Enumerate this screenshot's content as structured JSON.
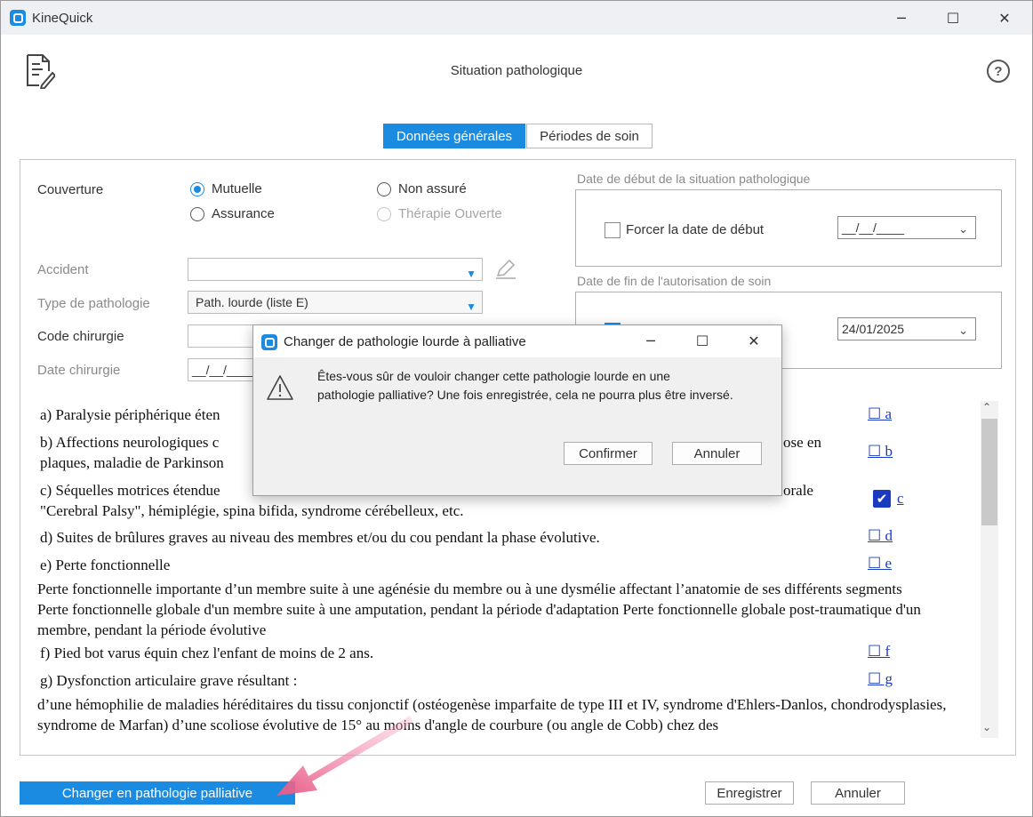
{
  "window": {
    "title": "KineQuick",
    "minimize_glyph": "─",
    "maximize_glyph": "☐",
    "close_glyph": "✕"
  },
  "header": {
    "title": "Situation pathologique",
    "help_glyph": "?"
  },
  "tabs": [
    {
      "label": "Données générales",
      "active": true
    },
    {
      "label": "Périodes de soin",
      "active": false
    }
  ],
  "form": {
    "couverture_label": "Couverture",
    "radios": {
      "mutuelle": "Mutuelle",
      "non_assure": "Non assuré",
      "assurance": "Assurance",
      "therapie_ouverte": "Thérapie Ouverte"
    },
    "selected_coverage": "Mutuelle",
    "accident_label": "Accident",
    "accident_value": "",
    "type_label": "Type de pathologie",
    "type_value": "Path. lourde (liste E)",
    "code_label": "Code chirurgie",
    "code_value": "",
    "date_label": "Date chirurgie",
    "date_value": "__/__/____"
  },
  "date_start": {
    "legend": "Date de début de la situation pathologique",
    "checkbox_label": "Forcer la date de début",
    "checked": false,
    "value": "__/__/____"
  },
  "date_end": {
    "legend": "Date de fin de l'autorisation de soin",
    "checked": true,
    "value": "24/01/2025"
  },
  "criteria": {
    "lines": {
      "a": "a) Paralysie périphérique éten",
      "b1": "b) Affections neurologiques c",
      "b1_tail": "ose en",
      "b2": "plaques, maladie de Parkinson",
      "c1": "c) Séquelles motrices étendue",
      "c1_tail": "orale",
      "c2": "\"Cerebral Palsy\", hémiplégie, spina bifida, syndrome cérébelleux, etc.",
      "d": "d) Suites de brûlures graves au niveau des membres et/ou du cou pendant la phase évolutive.",
      "e": "e) Perte fonctionnelle",
      "e_text": "Perte fonctionnelle importante d’un membre suite à une agénésie du membre ou à une dysmélie affectant l’anatomie de ses différents segments Perte fonctionnelle globale d'un membre suite à une amputation, pendant la période d'adaptation Perte fonctionnelle globale post-traumatique d'un membre, pendant la période évolutive",
      "f": "f) Pied bot varus équin chez l'enfant de moins de 2 ans.",
      "g": "g) Dysfonction articulaire grave résultant :",
      "g_text": "d’une hémophilie de maladies héréditaires du tissu conjonctif (ostéogenèse imparfaite de type III et IV, syndrome d'Ehlers-Danlos, chondrodysplasies, syndrome de Marfan) d’une scoliose évolutive de 15° au moins d'angle de courbure (ou angle de Cobb) chez des"
    },
    "links": {
      "a": "☐ a",
      "b": "☐ b",
      "c": "c",
      "d": "☐ d",
      "e": "☐ e",
      "f": "☐ f",
      "g": "☐ g"
    },
    "checked": [
      "c"
    ]
  },
  "footer": {
    "palliative_button": "Changer en pathologie palliative",
    "save_button": "Enregistrer",
    "cancel_button": "Annuler"
  },
  "dialog": {
    "title": "Changer de pathologie lourde à palliative",
    "message_line1": "Êtes-vous sûr de vouloir changer cette pathologie lourde en une",
    "message_line2": "pathologie palliative? Une fois enregistrée, cela ne pourra plus être inversé.",
    "confirm_button": "Confirmer",
    "cancel_button": "Annuler"
  },
  "colors": {
    "accent": "#1a8be0",
    "link": "#1a3bc0",
    "annotation_arrow": "#e85a86"
  }
}
